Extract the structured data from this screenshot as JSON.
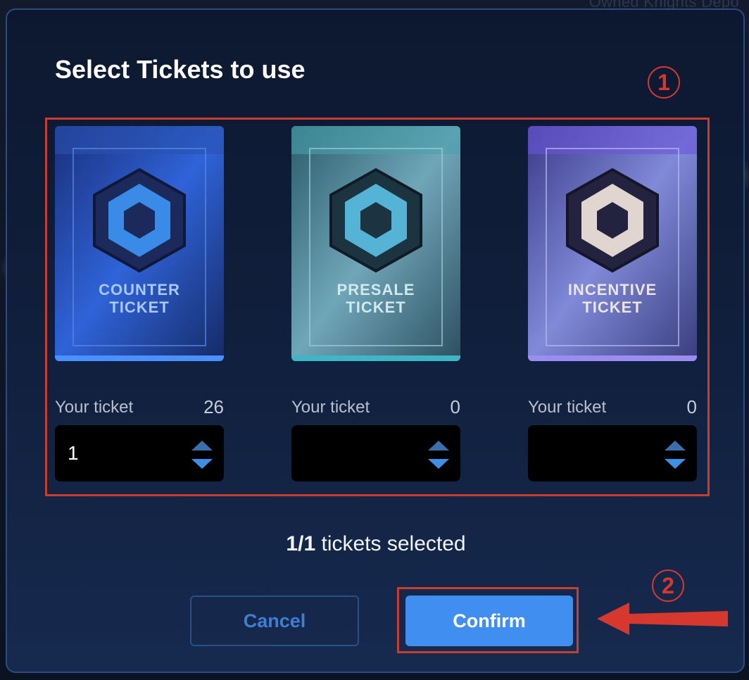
{
  "background": {
    "partial_text": "Owned Knights Depo"
  },
  "modal": {
    "title": "Select Tickets to use",
    "tickets": [
      {
        "name_line1": "COUNTER",
        "name_line2": "TICKET",
        "label": "Your ticket",
        "count": "26",
        "value": "1",
        "accent": "#2f5fd0"
      },
      {
        "name_line1": "PRESALE",
        "name_line2": "TICKET",
        "label": "Your ticket",
        "count": "0",
        "value": "",
        "accent": "#3fa6b5"
      },
      {
        "name_line1": "INCENTIVE",
        "name_line2": "TICKET",
        "label": "Your ticket",
        "count": "0",
        "value": "",
        "accent": "#7a6ad8"
      }
    ],
    "selected": {
      "count": "1/1",
      "suffix": "tickets selected"
    },
    "cancel_label": "Cancel",
    "confirm_label": "Confirm"
  },
  "annotations": {
    "marker_1": "1",
    "marker_2": "2"
  },
  "colors": {
    "primary": "#3f8ef0",
    "annotation": "#d7382d",
    "modal_bg": "#0f1d39"
  }
}
